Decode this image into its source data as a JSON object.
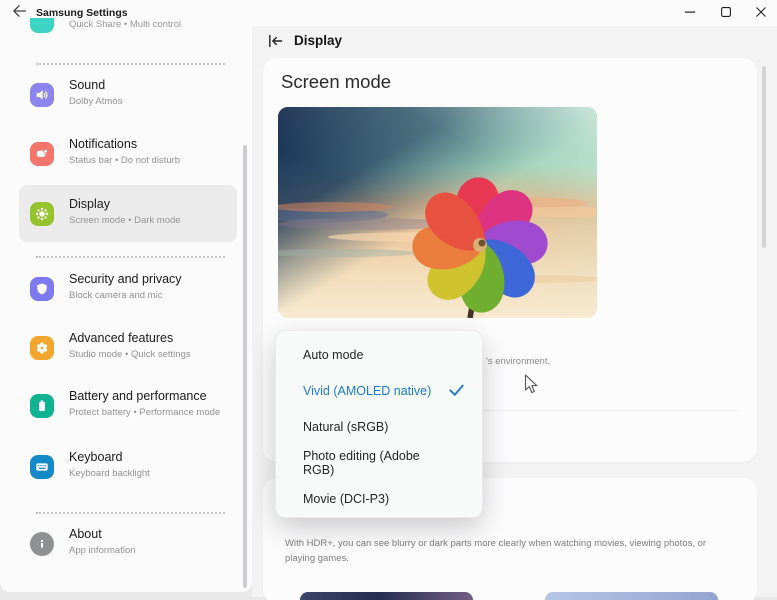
{
  "window": {
    "title": "Samsung Settings",
    "controls": {
      "minimize": "minimize",
      "maximize": "maximize",
      "close": "close"
    }
  },
  "sidebar": {
    "peek_item": {
      "subtitle": "Quick Share  •  Multi control",
      "color": "#3ed4c5"
    },
    "items": [
      {
        "title": "Sound",
        "subtitle": "Dolby Atmos",
        "color": "#8c85ee",
        "icon": "speaker-icon"
      },
      {
        "title": "Notifications",
        "subtitle": "Status bar  •  Do not disturb",
        "color": "#f3756c",
        "icon": "notification-bubble-icon"
      },
      {
        "title": "Display",
        "subtitle": "Screen mode  •  Dark mode",
        "color": "#96c22e",
        "icon": "display-sun-icon",
        "selected": true
      },
      {
        "title": "Security and privacy",
        "subtitle": "Block camera and mic",
        "color": "#7d79ef",
        "icon": "shield-icon"
      },
      {
        "title": "Advanced features",
        "subtitle": "Studio mode  •  Quick settings",
        "color": "#f3a62e",
        "icon": "flower-gear-icon"
      },
      {
        "title": "Battery and performance",
        "subtitle": "Protect battery  •  Performance mode",
        "color": "#10b391",
        "icon": "battery-icon"
      },
      {
        "title": "Keyboard",
        "subtitle": "Keyboard backlight",
        "color": "#1489c8",
        "icon": "keyboard-icon"
      },
      {
        "title": "About",
        "subtitle": "App information",
        "color": "#8f9091",
        "icon": "info-icon"
      }
    ]
  },
  "main": {
    "page_title": "Display",
    "screen_mode": {
      "title": "Screen mode",
      "description_visible_tail": "'s environment."
    },
    "hdr": {
      "description": "With HDR+, you can see blurry or dark parts more clearly when watching movies, viewing photos, or playing games."
    }
  },
  "dropdown": {
    "accent_color": "#1b7ed8",
    "items": [
      {
        "label": "Auto mode",
        "selected": false
      },
      {
        "label": "Vivid (AMOLED native)",
        "selected": true
      },
      {
        "label": "Natural (sRGB)",
        "selected": false
      },
      {
        "label": "Photo editing (Adobe RGB)",
        "selected": false
      },
      {
        "label": "Movie (DCI-P3)",
        "selected": false
      }
    ]
  }
}
